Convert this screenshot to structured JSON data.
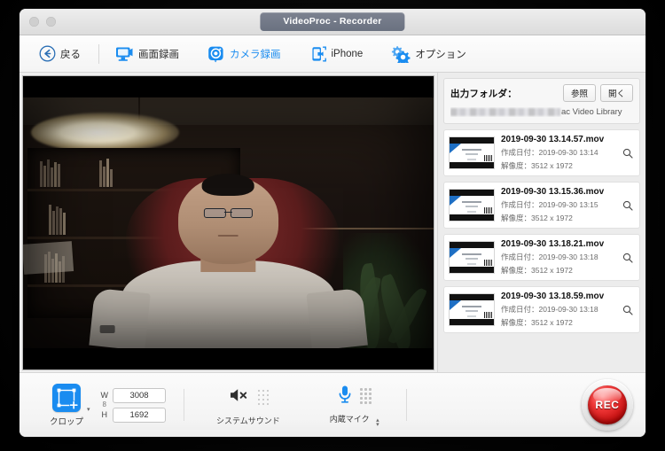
{
  "window": {
    "title": "VideoProc - Recorder",
    "traffic_lights": [
      "close",
      "minimize"
    ]
  },
  "toolbar": {
    "back": {
      "label": "戻る",
      "icon": "back-arrow-circle-icon"
    },
    "items": [
      {
        "label": "画面録画",
        "icon": "monitor-record-icon",
        "active": false
      },
      {
        "label": "カメラ録画",
        "icon": "camera-record-icon",
        "active": true
      },
      {
        "label": "iPhone",
        "icon": "iphone-icon",
        "active": false
      },
      {
        "label": "オプション",
        "icon": "gear-options-icon",
        "active": false
      }
    ],
    "accent_color": "#1a8cf0"
  },
  "preview": {
    "source": "camera-live-preview",
    "letterboxed": true
  },
  "right_panel": {
    "output_folder_label": "出力フォルダ：",
    "browse_button": "参照",
    "open_button": "開く",
    "path_visible_tail": "ac Video Library",
    "path_redacted": true,
    "files": [
      {
        "name": "2019-09-30 13.14.57.mov",
        "created_label": "作成日付：2019-09-30 13:14",
        "resolution_label": "解像度：3512 x 1972"
      },
      {
        "name": "2019-09-30 13.15.36.mov",
        "created_label": "作成日付：2019-09-30 13:15",
        "resolution_label": "解像度：3512 x 1972"
      },
      {
        "name": "2019-09-30 13.18.21.mov",
        "created_label": "作成日付：2019-09-30 13:18",
        "resolution_label": "解像度：3512 x 1972"
      },
      {
        "name": "2019-09-30 13.18.59.mov",
        "created_label": "作成日付：2019-09-30 13:18",
        "resolution_label": "解像度：3512 x 1972"
      }
    ]
  },
  "bottom_bar": {
    "crop": {
      "label": "クロップ",
      "icon": "crop-add-icon",
      "caret": "▾",
      "width_label": "W",
      "height_label": "H",
      "link_glyph": "8",
      "width_value": "3008",
      "height_value": "1692"
    },
    "system_sound": {
      "label": "システムサウンド",
      "icon": "speaker-muted-icon",
      "enabled": false
    },
    "microphone": {
      "label": "内蔵マイク",
      "icon": "microphone-icon",
      "enabled": true,
      "stepper_up": "▴",
      "stepper_down": "▾"
    },
    "record_button": {
      "label": "REC",
      "color": "#d61b1b"
    }
  }
}
